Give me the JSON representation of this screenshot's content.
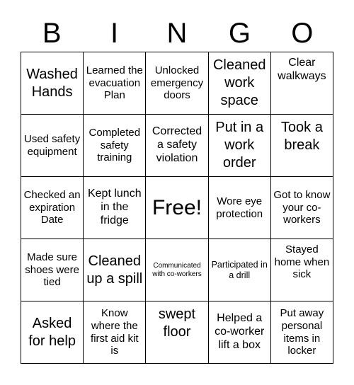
{
  "header": {
    "letters": [
      "B",
      "I",
      "N",
      "G",
      "O"
    ]
  },
  "cells": [
    "Washed Hands",
    "Learned the evacuation Plan",
    "Unlocked emergency doors",
    "Cleaned work space",
    "Clear walkways",
    "Used safety equipment",
    "Completed safety training",
    "Corrected a safety violation",
    "Put in a work order",
    "Took a break",
    "Checked an expiration Date",
    "Kept lunch in the fridge",
    "Free!",
    "Wore eye protection",
    "Got to know your co-workers",
    "Made sure shoes were tied",
    "Cleaned up a spill",
    "Communicated with co-workers",
    "Participated in a drill",
    "Stayed home when sick",
    "Asked for help",
    "Know where the first aid kit is",
    "swept floor",
    "Helped a co-worker lift a box",
    "Put away personal items in locker"
  ]
}
